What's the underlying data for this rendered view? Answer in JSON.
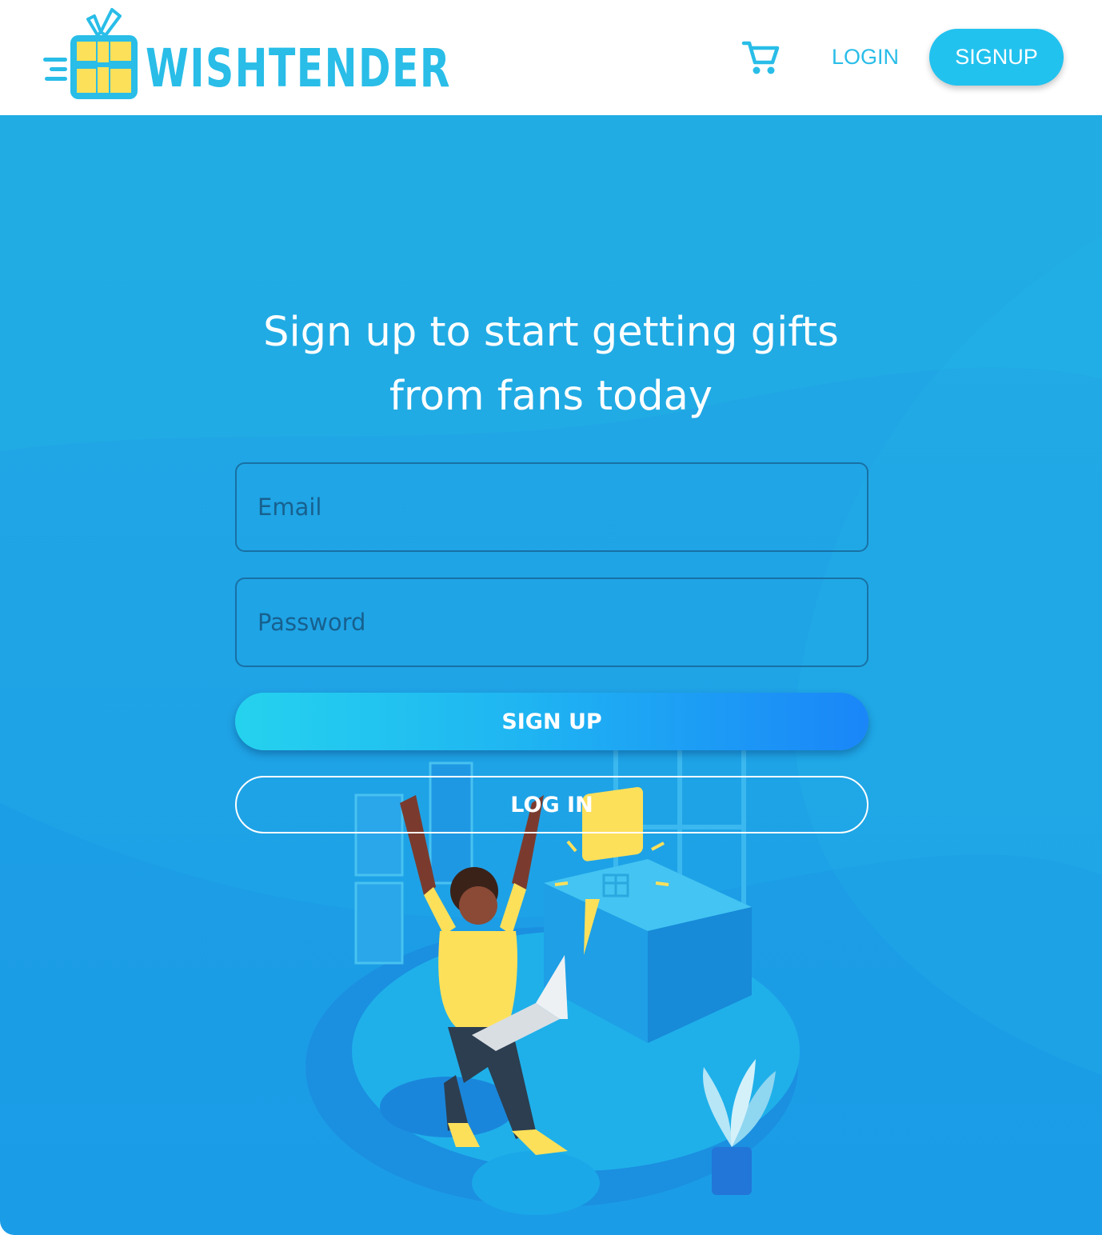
{
  "header": {
    "brand": "WISHTENDER",
    "cart_icon": "shopping-cart-icon",
    "login_label": "LOGIN",
    "signup_label": "SIGNUP"
  },
  "hero": {
    "headline_line1": "Sign up to start getting gifts",
    "headline_line2": "from fans today",
    "email_placeholder": "Email",
    "password_placeholder": "Password",
    "signup_button": "SIGN UP",
    "login_button": "LOG IN",
    "illustration": "woman-celebrating-gift-illustration"
  },
  "colors": {
    "brand": "#29bde8",
    "accent_yellow": "#fde05a",
    "hero_blue": "#1fa4e6"
  }
}
